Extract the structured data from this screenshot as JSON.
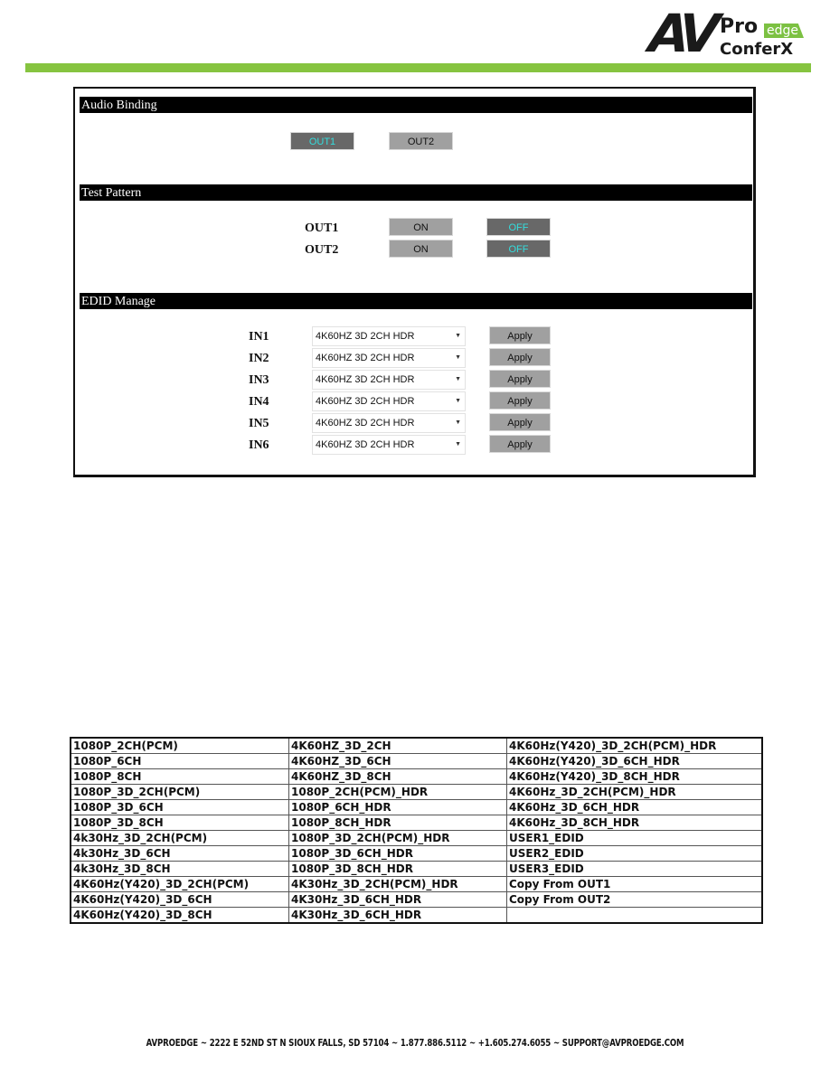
{
  "logo": {
    "brand_av": "AV",
    "brand_pro": "Pro",
    "brand_edge": "edge",
    "product": "ConferX",
    "accent_color": "#86c440"
  },
  "panel": {
    "audio_binding": {
      "title": "Audio Binding",
      "buttons": [
        {
          "label": "OUT1",
          "active": true
        },
        {
          "label": "OUT2",
          "active": false
        }
      ]
    },
    "test_pattern": {
      "title": "Test Pattern",
      "rows": [
        {
          "label": "OUT1",
          "on_label": "ON",
          "off_label": "OFF",
          "state": "OFF"
        },
        {
          "label": "OUT2",
          "on_label": "ON",
          "off_label": "OFF",
          "state": "OFF"
        }
      ]
    },
    "edid_manage": {
      "title": "EDID Manage",
      "apply_label": "Apply",
      "rows": [
        {
          "label": "IN1",
          "value": "4K60HZ 3D 2CH HDR"
        },
        {
          "label": "IN2",
          "value": "4K60HZ 3D 2CH HDR"
        },
        {
          "label": "IN3",
          "value": "4K60HZ 3D 2CH HDR"
        },
        {
          "label": "IN4",
          "value": "4K60HZ 3D 2CH HDR"
        },
        {
          "label": "IN5",
          "value": "4K60HZ 3D 2CH HDR"
        },
        {
          "label": "IN6",
          "value": "4K60HZ 3D 2CH HDR"
        }
      ]
    },
    "colors": {
      "active_bg": "#686868",
      "active_text": "#33dddd",
      "inactive_bg": "#a0a0a0"
    }
  },
  "edid_table": {
    "rows": [
      [
        "1080P_2CH(PCM)",
        "4K60HZ_3D_2CH",
        "4K60Hz(Y420)_3D_2CH(PCM)_HDR"
      ],
      [
        "1080P_6CH",
        "4K60HZ_3D_6CH",
        "4K60Hz(Y420)_3D_6CH_HDR"
      ],
      [
        "1080P_8CH",
        "4K60HZ_3D_8CH",
        "4K60Hz(Y420)_3D_8CH_HDR"
      ],
      [
        "1080P_3D_2CH(PCM)",
        "1080P_2CH(PCM)_HDR",
        "4K60Hz_3D_2CH(PCM)_HDR"
      ],
      [
        "1080P_3D_6CH",
        "1080P_6CH_HDR",
        "4K60Hz_3D_6CH_HDR"
      ],
      [
        "1080P_3D_8CH",
        "1080P_8CH_HDR",
        "4K60Hz_3D_8CH_HDR"
      ],
      [
        "4k30Hz_3D_2CH(PCM)",
        "1080P_3D_2CH(PCM)_HDR",
        "USER1_EDID"
      ],
      [
        "4k30Hz_3D_6CH",
        "1080P_3D_6CH_HDR",
        "USER2_EDID"
      ],
      [
        "4k30Hz_3D_8CH",
        "1080P_3D_8CH_HDR",
        "USER3_EDID"
      ],
      [
        "4K60Hz(Y420)_3D_2CH(PCM)",
        "4K30Hz_3D_2CH(PCM)_HDR",
        "Copy From OUT1"
      ],
      [
        "4K60Hz(Y420)_3D_6CH",
        "4K30Hz_3D_6CH_HDR",
        "Copy From OUT2"
      ],
      [
        "4K60Hz(Y420)_3D_8CH",
        "4K30Hz_3D_6CH_HDR",
        ""
      ]
    ]
  },
  "footer": {
    "text": "AVPROEDGE ~ 2222 E 52ND ST N SIOUX FALLS, SD 57104 ~ 1.877.886.5112 ~ +1.605.274.6055 ~ SUPPORT@AVPROEDGE.COM"
  }
}
